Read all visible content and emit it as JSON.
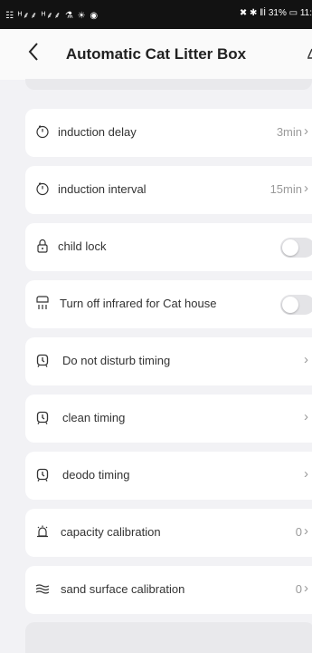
{
  "status_bar": {
    "left": "☷ ᴴ⸙⸙ ᴴ⸙⸙ ⚗ ☀ ◉",
    "right": "✖ ✱ ‖İ 31% ▭ 11:"
  },
  "header": {
    "title": "Automatic Cat Litter Box"
  },
  "settings": [
    {
      "label": "induction delay",
      "value": "3min",
      "icon": "timer-icon"
    },
    {
      "label": "induction interval",
      "value": "15min",
      "icon": "timer-icon"
    },
    {
      "label": "child lock",
      "icon": "lock-icon",
      "toggle": false
    },
    {
      "label": "Turn off infrared for Cat house",
      "icon": "cat-house-icon",
      "toggle": false
    },
    {
      "label": "Do not disturb timing",
      "icon": "alarm-clock-icon"
    },
    {
      "label": "clean timing",
      "icon": "alarm-clock-icon"
    },
    {
      "label": "deodo timing",
      "icon": "alarm-clock-icon"
    },
    {
      "label": "capacity calibration",
      "value": "0",
      "icon": "bell-icon"
    },
    {
      "label": "sand surface calibration",
      "value": "0",
      "icon": "waves-icon"
    }
  ]
}
